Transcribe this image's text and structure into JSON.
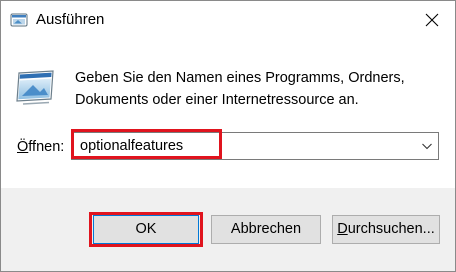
{
  "window": {
    "title": "Ausführen",
    "close_glyph": "✕"
  },
  "description": {
    "line1": "Geben Sie den Namen eines Programms, Ordners,",
    "line2": "Dokuments oder einer Internetressource an."
  },
  "open_field": {
    "label_accel": "Ö",
    "label_rest": "ffnen:",
    "value": "optionalfeatures"
  },
  "buttons": {
    "ok": "OK",
    "cancel": "Abbrechen",
    "browse_accel": "D",
    "browse_rest": "urchsuchen..."
  },
  "colors": {
    "highlight": "#e0141e",
    "footer_bg": "#f0f0f0",
    "button_bg": "#e1e1e1",
    "focus_border": "#0078d7"
  },
  "icons": {
    "title": "run-icon",
    "dialog": "run-icon",
    "close": "close-icon",
    "dropdown": "chevron-down-icon"
  }
}
